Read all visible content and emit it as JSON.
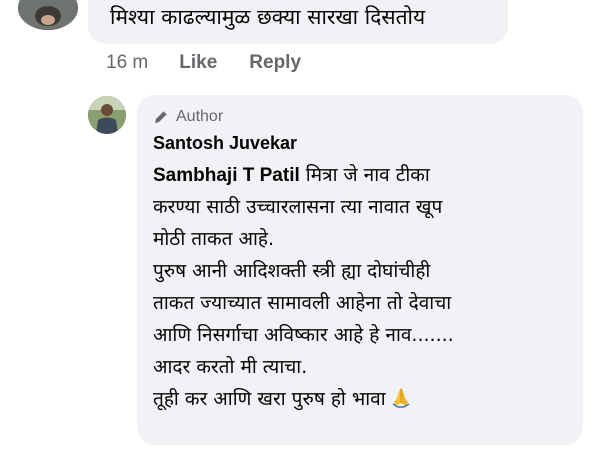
{
  "top_comment": {
    "text": "मिश्या काढल्यामुळ छक्या सारखा दिसतोय",
    "time": "16 m",
    "like_label": "Like",
    "reply_label": "Reply"
  },
  "reply": {
    "badge": "Author",
    "author": "Santosh Juvekar",
    "mention": "Sambhaji T Patil",
    "lines": [
      " मित्रा जे नाव टीका",
      "करण्या साठी उच्चारलासना त्या नावात खूप",
      "मोठी ताकत आहे.",
      "पुरुष आनी आदिशक्ती स्त्री ह्या दोघांचीही",
      "ताकत ज्याच्यात सामावली आहेना तो देवाचा",
      "आणि निसर्गाचा अविष्कार आहे हे नाव.......",
      "आदर करतो मी त्याचा.",
      "तूही कर आणि खरा पुरुष हो भावा"
    ],
    "emoji_icon": "folded-hands-icon"
  }
}
